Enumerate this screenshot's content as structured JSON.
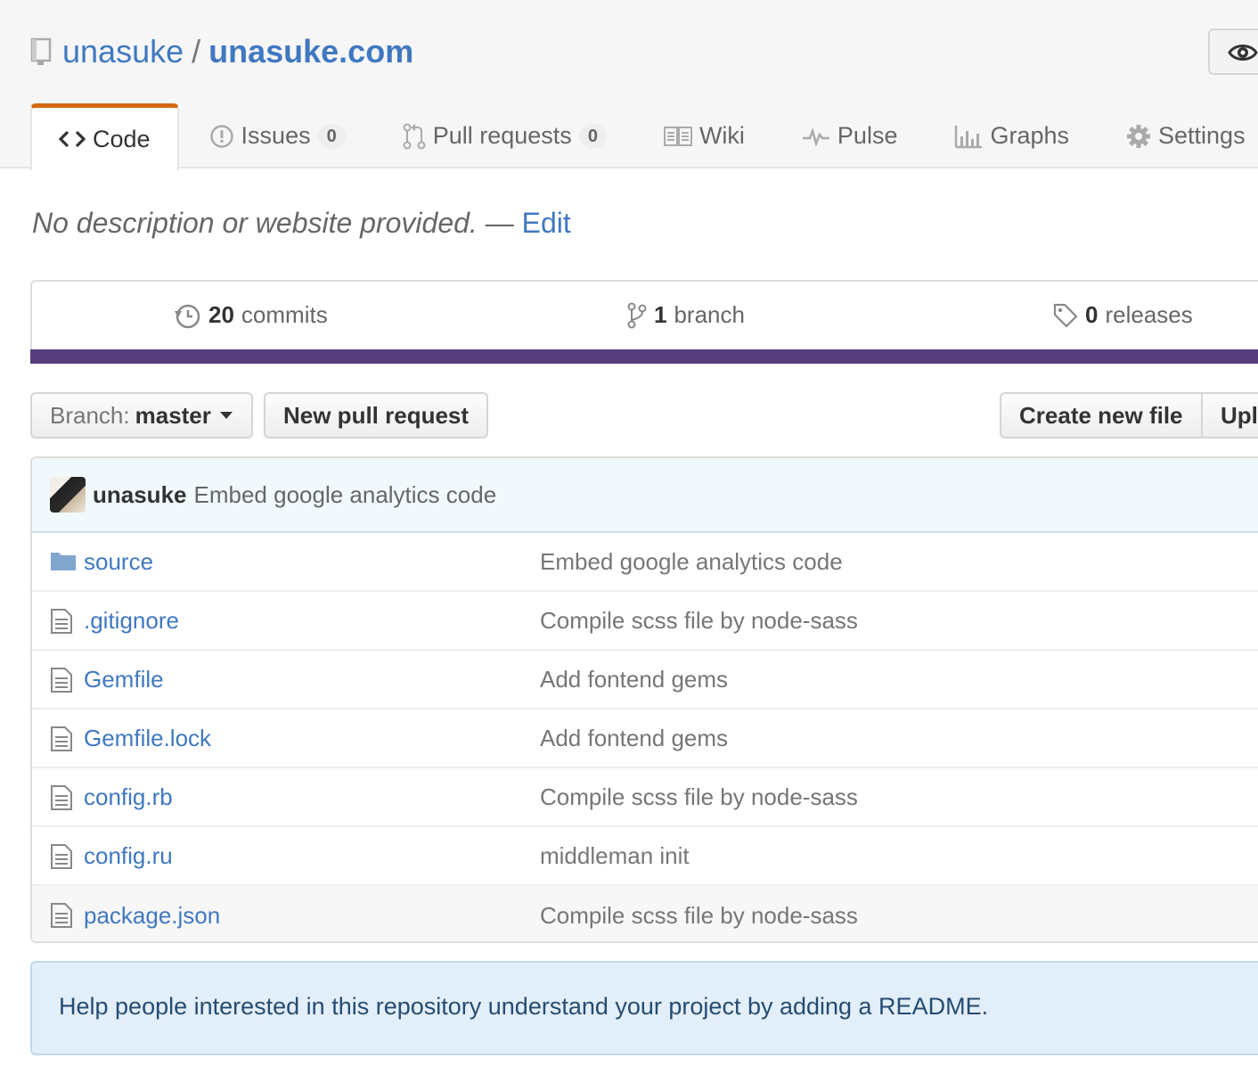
{
  "repo": {
    "owner": "unasuke",
    "separator": "/",
    "name": "unasuke.com"
  },
  "header": {
    "tabs": [
      {
        "label": "Code",
        "icon": "code-icon",
        "selected": true
      },
      {
        "label": "Issues",
        "icon": "issue-icon",
        "count": "0"
      },
      {
        "label": "Pull requests",
        "icon": "pull-request-icon",
        "count": "0"
      },
      {
        "label": "Wiki",
        "icon": "book-icon"
      },
      {
        "label": "Pulse",
        "icon": "pulse-icon"
      },
      {
        "label": "Graphs",
        "icon": "graph-icon"
      },
      {
        "label": "Settings",
        "icon": "gear-icon"
      }
    ]
  },
  "description": {
    "text": "No description or website provided.",
    "dash": "—",
    "edit": "Edit"
  },
  "numbers": {
    "commits": {
      "count": "20",
      "label": "commits"
    },
    "branches": {
      "count": "1",
      "label": "branch"
    },
    "releases": {
      "count": "0",
      "label": "releases"
    },
    "language_bar_color": "#563d7c"
  },
  "toolbar": {
    "branch_prefix": "Branch:",
    "branch_name": "master",
    "new_pull_request": "New pull request",
    "create_new_file": "Create new file",
    "upload": "Upl"
  },
  "latest_commit": {
    "author": "unasuke",
    "message": "Embed google analytics code"
  },
  "files": [
    {
      "name": "source",
      "type": "dir",
      "message": "Embed google analytics code"
    },
    {
      "name": ".gitignore",
      "type": "file",
      "message": "Compile scss file by node-sass"
    },
    {
      "name": "Gemfile",
      "type": "file",
      "message": "Add fontend gems"
    },
    {
      "name": "Gemfile.lock",
      "type": "file",
      "message": "Add fontend gems"
    },
    {
      "name": "config.rb",
      "type": "file",
      "message": "Compile scss file by node-sass"
    },
    {
      "name": "config.ru",
      "type": "file",
      "message": "middleman init"
    },
    {
      "name": "package.json",
      "type": "file",
      "message": "Compile scss file by node-sass"
    }
  ],
  "readme_prompt": "Help people interested in this repository understand your project by adding a README.",
  "colors": {
    "link": "#4078c0",
    "selected_tab_accent": "#d26911",
    "commit_tease_bg": "#f2f9fc",
    "readme_bg": "#e2eef9"
  }
}
